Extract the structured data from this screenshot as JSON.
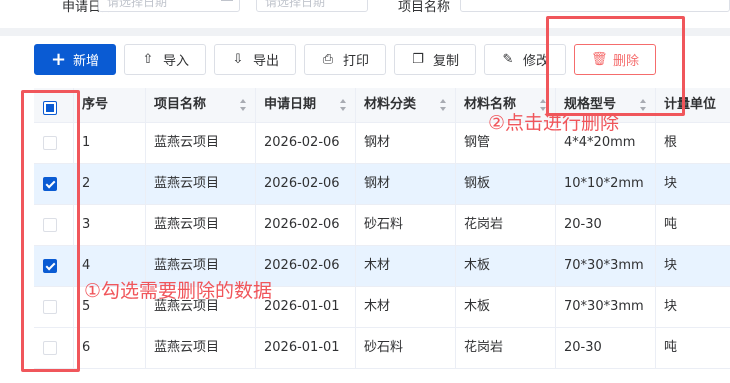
{
  "filters": {
    "date_label": "申请日期",
    "start_placeholder": "请选择日期",
    "end_placeholder": "请选择日期",
    "project_label": "项目名称"
  },
  "toolbar": {
    "add": "新增",
    "import": "导入",
    "export": "导出",
    "print": "打印",
    "copy": "复制",
    "edit": "修改",
    "delete": "删除"
  },
  "table": {
    "columns": [
      "序号",
      "项目名称",
      "申请日期",
      "材料分类",
      "材料名称",
      "规格型号",
      "计量单位"
    ],
    "rows": [
      {
        "checked": false,
        "cells": [
          "1",
          "蓝燕云项目",
          "2026-02-06",
          "钢材",
          "钢管",
          "4*4*20mm",
          "根"
        ]
      },
      {
        "checked": true,
        "cells": [
          "2",
          "蓝燕云项目",
          "2026-02-06",
          "钢材",
          "钢板",
          "10*10*2mm",
          "块"
        ]
      },
      {
        "checked": false,
        "cells": [
          "3",
          "蓝燕云项目",
          "2026-02-06",
          "砂石料",
          "花岗岩",
          "20-30",
          "吨"
        ]
      },
      {
        "checked": true,
        "cells": [
          "4",
          "蓝燕云项目",
          "2026-02-06",
          "木材",
          "木板",
          "70*30*3mm",
          "块"
        ]
      },
      {
        "checked": false,
        "cells": [
          "5",
          "蓝燕云项目",
          "2026-01-01",
          "木材",
          "木板",
          "70*30*3mm",
          "块"
        ]
      },
      {
        "checked": false,
        "cells": [
          "6",
          "蓝燕云项目",
          "2026-01-01",
          "砂石料",
          "花岗岩",
          "20-30",
          "吨"
        ]
      }
    ]
  },
  "annotations": {
    "step1": "①勾选需要删除的数据",
    "step2": "②点击进行删除"
  },
  "colors": {
    "primary": "#0a5bd3",
    "danger": "#f56c6c",
    "annotation": "#f0565b",
    "selected_row": "#e8f3ff"
  }
}
